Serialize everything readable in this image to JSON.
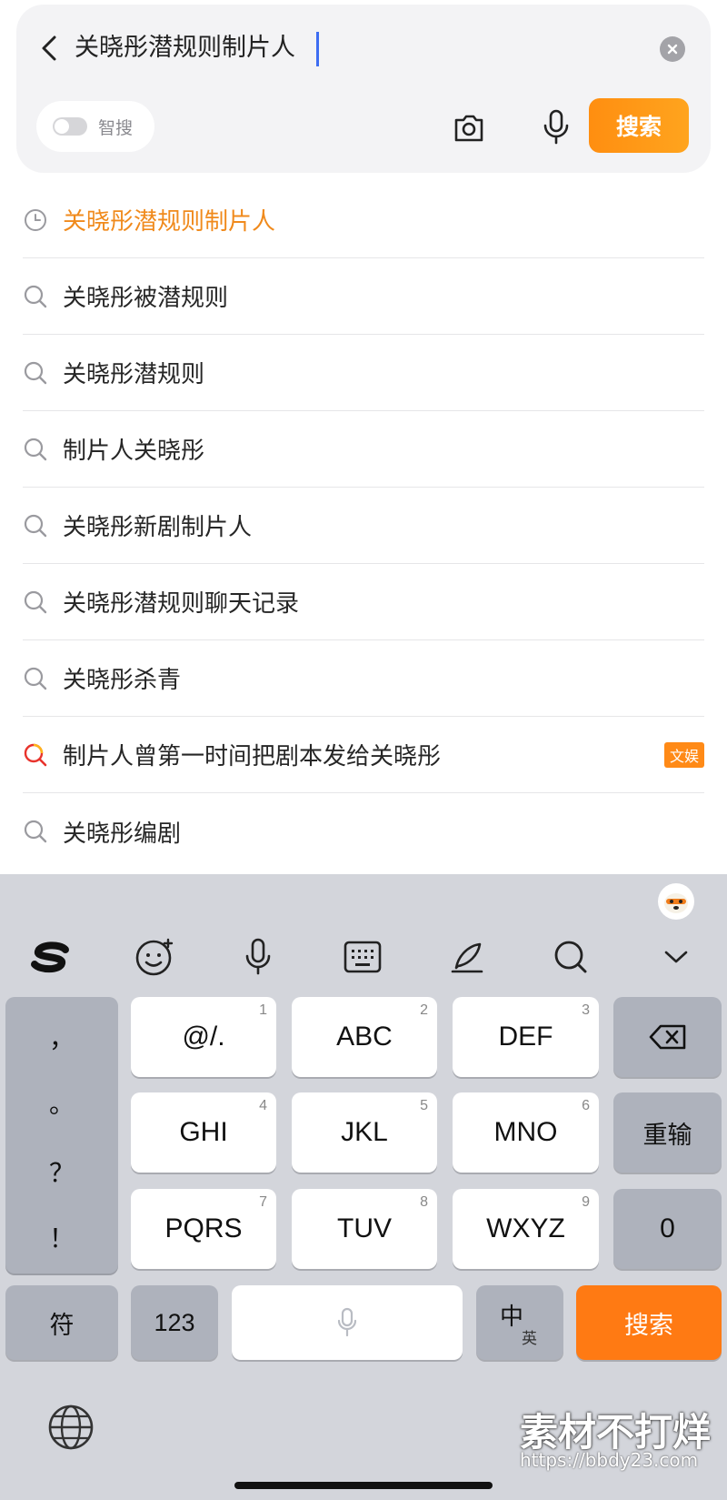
{
  "search": {
    "query": "关晓彤潜规则制片人",
    "smart_label": "智搜",
    "button_label": "搜索"
  },
  "suggestions": [
    {
      "text": "关晓彤潜规则制片人",
      "type": "history"
    },
    {
      "text": "关晓彤被潜规则",
      "type": "search"
    },
    {
      "text": "关晓彤潜规则",
      "type": "search"
    },
    {
      "text": "制片人关晓彤",
      "type": "search"
    },
    {
      "text": "关晓彤新剧制片人",
      "type": "search"
    },
    {
      "text": "关晓彤潜规则聊天记录",
      "type": "search"
    },
    {
      "text": "关晓彤杀青",
      "type": "search"
    },
    {
      "text": "制片人曾第一时间把剧本发给关晓彤",
      "type": "hot",
      "tag": "文娱"
    },
    {
      "text": "关晓彤编剧",
      "type": "search"
    }
  ],
  "keyboard": {
    "toolbar_icons": [
      "sogou-logo-icon",
      "emoji-icon",
      "voice-icon",
      "keyboard-icon",
      "handwriting-icon",
      "search-icon",
      "collapse-icon"
    ],
    "punctuation": [
      "，",
      "。",
      "？",
      "！"
    ],
    "keys": {
      "k1": {
        "label": "@/.",
        "num": "1"
      },
      "k2": {
        "label": "ABC",
        "num": "2"
      },
      "k3": {
        "label": "DEF",
        "num": "3"
      },
      "k4": {
        "label": "GHI",
        "num": "4"
      },
      "k5": {
        "label": "JKL",
        "num": "5"
      },
      "k6": {
        "label": "MNO",
        "num": "6"
      },
      "k7": {
        "label": "PQRS",
        "num": "7"
      },
      "k8": {
        "label": "TUV",
        "num": "8"
      },
      "k9": {
        "label": "WXYZ",
        "num": "9"
      },
      "reenter": "重输",
      "zero": "0",
      "symbols": "符",
      "numbers": "123",
      "lang_primary": "中",
      "lang_secondary": "英",
      "search": "搜索"
    }
  },
  "watermark": {
    "text": "素材不打烊",
    "url": "https://bbdy23.com"
  },
  "colors": {
    "accent_orange": "#ff8e10",
    "history_text": "#f08a1c",
    "caret": "#3d6df2",
    "keyboard_bg": "#d3d5db"
  }
}
